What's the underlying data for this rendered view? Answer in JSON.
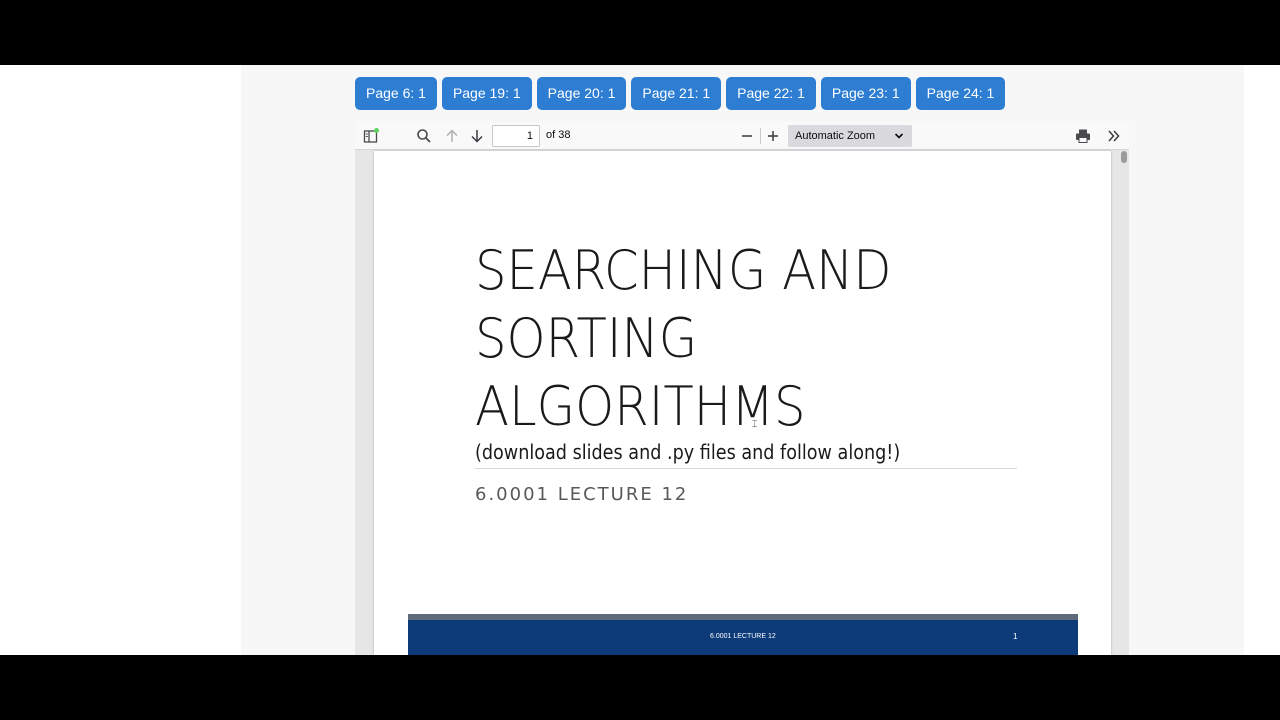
{
  "page_buttons": [
    "Page 6: 1",
    "Page 19: 1",
    "Page 20: 1",
    "Page 21: 1",
    "Page 22: 1",
    "Page 23: 1",
    "Page 24: 1"
  ],
  "toolbar": {
    "page_number": "1",
    "page_total": "of 38",
    "zoom_label": "Automatic Zoom"
  },
  "slide": {
    "title_line1": "SEARCHING AND",
    "title_line2": "SORTING",
    "title_line3": "ALGORITHMS",
    "subtitle": "(download slides and .py files and follow along!)",
    "lecture": "6.0001 LECTURE 12",
    "footer_text": "6.0001 LECTURE 12",
    "footer_page": "1"
  },
  "colors": {
    "button_blue": "#2d7dd2",
    "footer_navy": "#0d3a79"
  },
  "icons": [
    "sidebar-toggle-icon",
    "search-icon",
    "arrow-up-icon",
    "arrow-down-icon",
    "minus-icon",
    "plus-icon",
    "chevron-down-icon",
    "print-icon",
    "double-chevron-right-icon"
  ]
}
